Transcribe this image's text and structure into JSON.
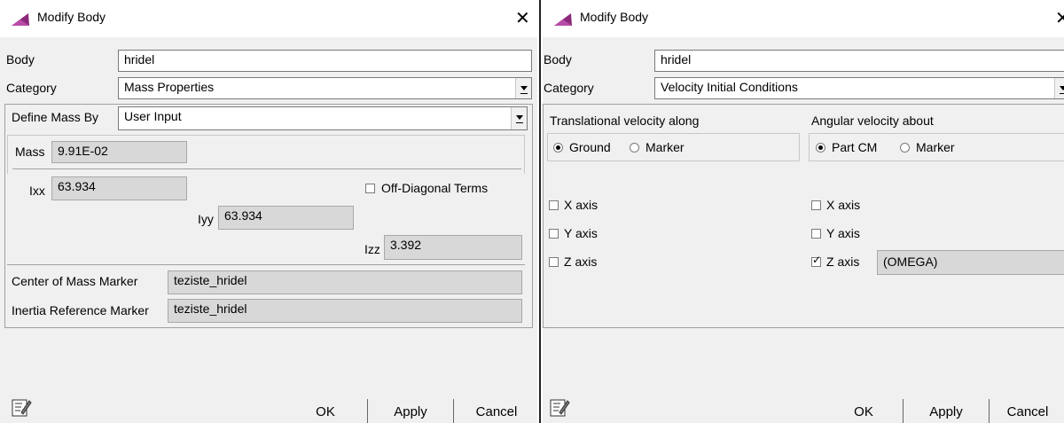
{
  "left": {
    "window_title": "Modify Body",
    "body_label": "Body",
    "body_value": "hridel",
    "category_label": "Category",
    "category_value": "Mass Properties",
    "define_mass_label": "Define Mass By",
    "define_mass_value": "User Input",
    "mass_label": "Mass",
    "mass_value": "9.91E-02",
    "ixx_label": "Ixx",
    "ixx_value": "63.934",
    "iyy_label": "Iyy",
    "iyy_value": "63.934",
    "izz_label": "Izz",
    "izz_value": "3.392",
    "off_diagonal_label": "Off-Diagonal Terms",
    "cm_marker_label": "Center of Mass Marker",
    "cm_marker_value": "teziste_hridel",
    "inertia_marker_label": "Inertia Reference Marker",
    "inertia_marker_value": "teziste_hridel",
    "ok_label": "OK",
    "apply_label": "Apply",
    "cancel_label": "Cancel"
  },
  "right": {
    "window_title": "Modify Body",
    "body_label": "Body",
    "body_value": "hridel",
    "category_label": "Category",
    "category_value": "Velocity Initial Conditions",
    "trans_heading": "Translational velocity along",
    "ang_heading": "Angular velocity about",
    "trans_radio_ground": "Ground",
    "trans_radio_marker": "Marker",
    "ang_radio_partcm": "Part CM",
    "ang_radio_marker": "Marker",
    "trans_x": "X axis",
    "trans_y": "Y axis",
    "trans_z": "Z axis",
    "ang_x": "X axis",
    "ang_y": "Y axis",
    "ang_z": "Z axis",
    "ang_z_value": "(OMEGA)",
    "ok_label": "OK",
    "apply_label": "Apply",
    "cancel_label": "Cancel"
  },
  "icons": {
    "app": "adams-logo-icon",
    "notes": "notes-icon",
    "close": "close-icon"
  },
  "colors": {
    "field_readonly": "#d8d8d8",
    "dialog_bg": "#f0f0f0",
    "logo": "#8b2a7b"
  }
}
